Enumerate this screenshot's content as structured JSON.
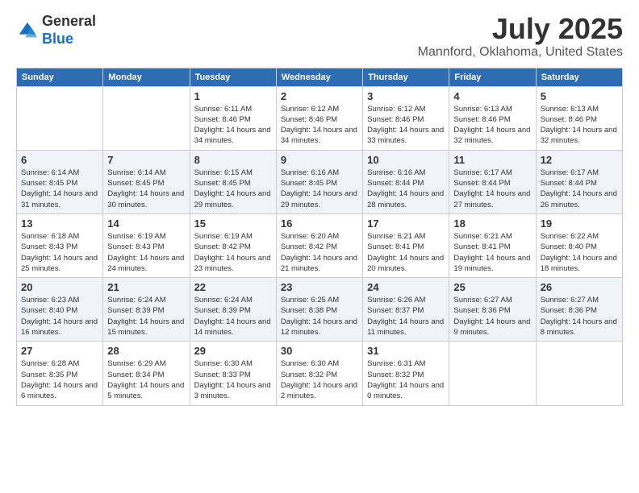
{
  "header": {
    "logo_line1": "General",
    "logo_line2": "Blue",
    "month": "July 2025",
    "location": "Mannford, Oklahoma, United States"
  },
  "weekdays": [
    "Sunday",
    "Monday",
    "Tuesday",
    "Wednesday",
    "Thursday",
    "Friday",
    "Saturday"
  ],
  "weeks": [
    [
      {
        "day": "",
        "sunrise": "",
        "sunset": "",
        "daylight": ""
      },
      {
        "day": "",
        "sunrise": "",
        "sunset": "",
        "daylight": ""
      },
      {
        "day": "1",
        "sunrise": "Sunrise: 6:11 AM",
        "sunset": "Sunset: 8:46 PM",
        "daylight": "Daylight: 14 hours and 34 minutes."
      },
      {
        "day": "2",
        "sunrise": "Sunrise: 6:12 AM",
        "sunset": "Sunset: 8:46 PM",
        "daylight": "Daylight: 14 hours and 34 minutes."
      },
      {
        "day": "3",
        "sunrise": "Sunrise: 6:12 AM",
        "sunset": "Sunset: 8:46 PM",
        "daylight": "Daylight: 14 hours and 33 minutes."
      },
      {
        "day": "4",
        "sunrise": "Sunrise: 6:13 AM",
        "sunset": "Sunset: 8:46 PM",
        "daylight": "Daylight: 14 hours and 32 minutes."
      },
      {
        "day": "5",
        "sunrise": "Sunrise: 6:13 AM",
        "sunset": "Sunset: 8:46 PM",
        "daylight": "Daylight: 14 hours and 32 minutes."
      }
    ],
    [
      {
        "day": "6",
        "sunrise": "Sunrise: 6:14 AM",
        "sunset": "Sunset: 8:45 PM",
        "daylight": "Daylight: 14 hours and 31 minutes."
      },
      {
        "day": "7",
        "sunrise": "Sunrise: 6:14 AM",
        "sunset": "Sunset: 8:45 PM",
        "daylight": "Daylight: 14 hours and 30 minutes."
      },
      {
        "day": "8",
        "sunrise": "Sunrise: 6:15 AM",
        "sunset": "Sunset: 8:45 PM",
        "daylight": "Daylight: 14 hours and 29 minutes."
      },
      {
        "day": "9",
        "sunrise": "Sunrise: 6:16 AM",
        "sunset": "Sunset: 8:45 PM",
        "daylight": "Daylight: 14 hours and 29 minutes."
      },
      {
        "day": "10",
        "sunrise": "Sunrise: 6:16 AM",
        "sunset": "Sunset: 8:44 PM",
        "daylight": "Daylight: 14 hours and 28 minutes."
      },
      {
        "day": "11",
        "sunrise": "Sunrise: 6:17 AM",
        "sunset": "Sunset: 8:44 PM",
        "daylight": "Daylight: 14 hours and 27 minutes."
      },
      {
        "day": "12",
        "sunrise": "Sunrise: 6:17 AM",
        "sunset": "Sunset: 8:44 PM",
        "daylight": "Daylight: 14 hours and 26 minutes."
      }
    ],
    [
      {
        "day": "13",
        "sunrise": "Sunrise: 6:18 AM",
        "sunset": "Sunset: 8:43 PM",
        "daylight": "Daylight: 14 hours and 25 minutes."
      },
      {
        "day": "14",
        "sunrise": "Sunrise: 6:19 AM",
        "sunset": "Sunset: 8:43 PM",
        "daylight": "Daylight: 14 hours and 24 minutes."
      },
      {
        "day": "15",
        "sunrise": "Sunrise: 6:19 AM",
        "sunset": "Sunset: 8:42 PM",
        "daylight": "Daylight: 14 hours and 23 minutes."
      },
      {
        "day": "16",
        "sunrise": "Sunrise: 6:20 AM",
        "sunset": "Sunset: 8:42 PM",
        "daylight": "Daylight: 14 hours and 21 minutes."
      },
      {
        "day": "17",
        "sunrise": "Sunrise: 6:21 AM",
        "sunset": "Sunset: 8:41 PM",
        "daylight": "Daylight: 14 hours and 20 minutes."
      },
      {
        "day": "18",
        "sunrise": "Sunrise: 6:21 AM",
        "sunset": "Sunset: 8:41 PM",
        "daylight": "Daylight: 14 hours and 19 minutes."
      },
      {
        "day": "19",
        "sunrise": "Sunrise: 6:22 AM",
        "sunset": "Sunset: 8:40 PM",
        "daylight": "Daylight: 14 hours and 18 minutes."
      }
    ],
    [
      {
        "day": "20",
        "sunrise": "Sunrise: 6:23 AM",
        "sunset": "Sunset: 8:40 PM",
        "daylight": "Daylight: 14 hours and 16 minutes."
      },
      {
        "day": "21",
        "sunrise": "Sunrise: 6:24 AM",
        "sunset": "Sunset: 8:39 PM",
        "daylight": "Daylight: 14 hours and 15 minutes."
      },
      {
        "day": "22",
        "sunrise": "Sunrise: 6:24 AM",
        "sunset": "Sunset: 8:39 PM",
        "daylight": "Daylight: 14 hours and 14 minutes."
      },
      {
        "day": "23",
        "sunrise": "Sunrise: 6:25 AM",
        "sunset": "Sunset: 8:38 PM",
        "daylight": "Daylight: 14 hours and 12 minutes."
      },
      {
        "day": "24",
        "sunrise": "Sunrise: 6:26 AM",
        "sunset": "Sunset: 8:37 PM",
        "daylight": "Daylight: 14 hours and 11 minutes."
      },
      {
        "day": "25",
        "sunrise": "Sunrise: 6:27 AM",
        "sunset": "Sunset: 8:36 PM",
        "daylight": "Daylight: 14 hours and 9 minutes."
      },
      {
        "day": "26",
        "sunrise": "Sunrise: 6:27 AM",
        "sunset": "Sunset: 8:36 PM",
        "daylight": "Daylight: 14 hours and 8 minutes."
      }
    ],
    [
      {
        "day": "27",
        "sunrise": "Sunrise: 6:28 AM",
        "sunset": "Sunset: 8:35 PM",
        "daylight": "Daylight: 14 hours and 6 minutes."
      },
      {
        "day": "28",
        "sunrise": "Sunrise: 6:29 AM",
        "sunset": "Sunset: 8:34 PM",
        "daylight": "Daylight: 14 hours and 5 minutes."
      },
      {
        "day": "29",
        "sunrise": "Sunrise: 6:30 AM",
        "sunset": "Sunset: 8:33 PM",
        "daylight": "Daylight: 14 hours and 3 minutes."
      },
      {
        "day": "30",
        "sunrise": "Sunrise: 6:30 AM",
        "sunset": "Sunset: 8:32 PM",
        "daylight": "Daylight: 14 hours and 2 minutes."
      },
      {
        "day": "31",
        "sunrise": "Sunrise: 6:31 AM",
        "sunset": "Sunset: 8:32 PM",
        "daylight": "Daylight: 14 hours and 0 minutes."
      },
      {
        "day": "",
        "sunrise": "",
        "sunset": "",
        "daylight": ""
      },
      {
        "day": "",
        "sunrise": "",
        "sunset": "",
        "daylight": ""
      }
    ]
  ]
}
